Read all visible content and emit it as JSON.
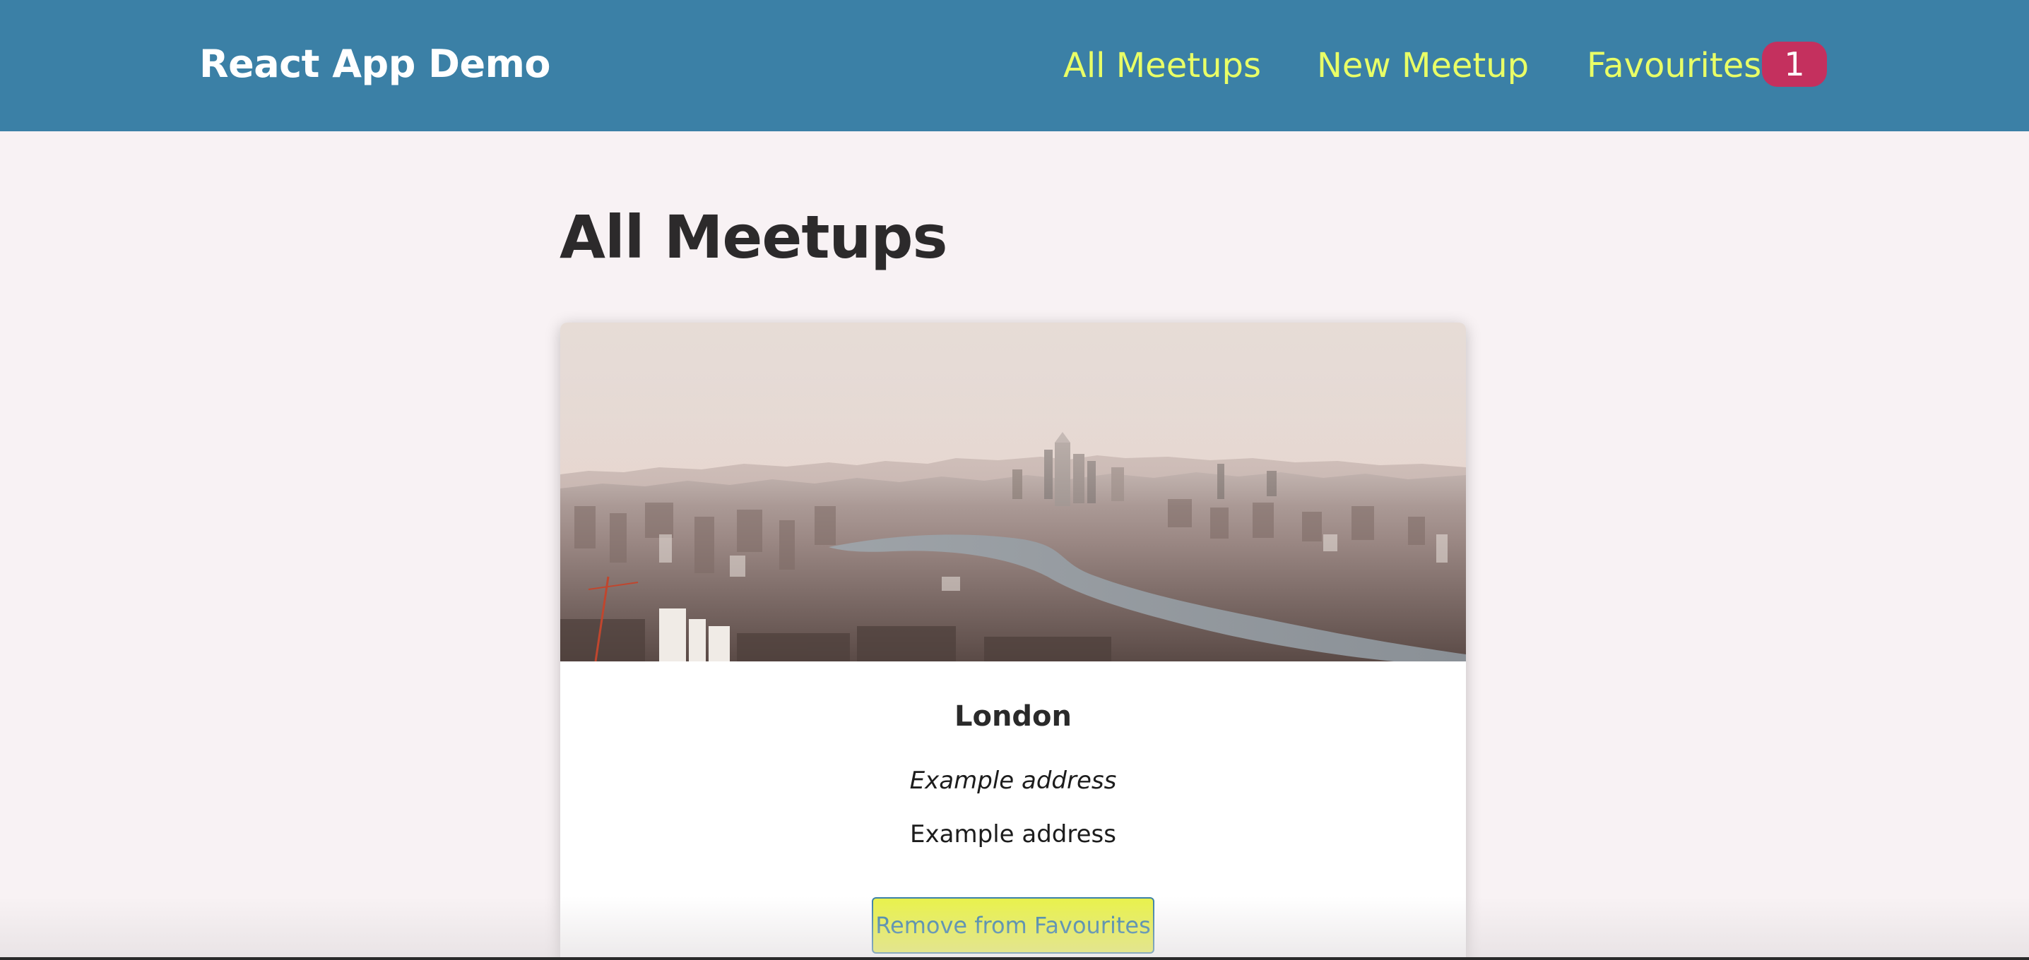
{
  "header": {
    "brand": "React App Demo",
    "nav": {
      "all_meetups": "All Meetups",
      "new_meetup": "New Meetup",
      "favourites": "Favourites",
      "favourites_count": "1"
    }
  },
  "main": {
    "title": "All Meetups",
    "meetups": [
      {
        "title": "London",
        "address": "Example address",
        "description": "Example address",
        "button_label": "Remove from Favourites"
      }
    ]
  },
  "colors": {
    "header_bg": "#3b80a6",
    "nav_link": "#e9ff66",
    "badge_bg": "#c4305e",
    "page_bg": "#f8f2f4",
    "button_bg": "#e9f24a"
  }
}
